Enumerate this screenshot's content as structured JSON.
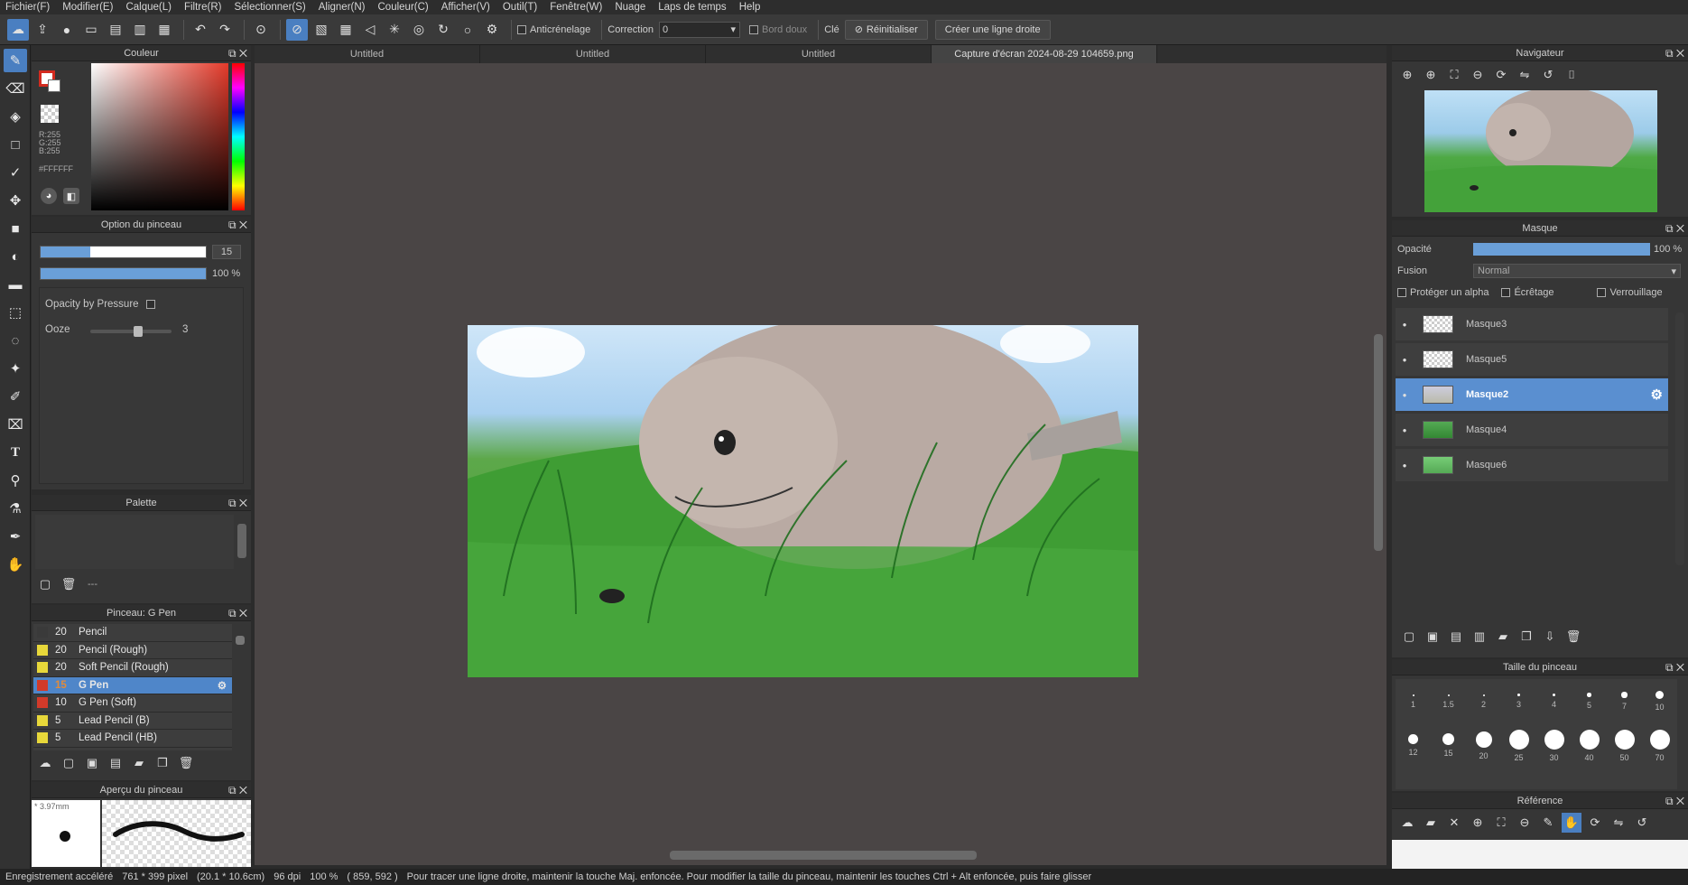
{
  "menu": [
    "Fichier(F)",
    "Modifier(E)",
    "Calque(L)",
    "Filtre(R)",
    "Sélectionner(S)",
    "Aligner(N)",
    "Couleur(C)",
    "Afficher(V)",
    "Outil(T)",
    "Fenêtre(W)",
    "Nuage",
    "Laps de temps",
    "Help"
  ],
  "toolbar": {
    "antialias": "Anticrénelage",
    "correction_label": "Correction",
    "correction_value": "0",
    "soft_edge": "Bord doux",
    "key": "Clé",
    "reset": "Réinitialiser",
    "straight_line": "Créer une ligne droite"
  },
  "tabs": [
    "Untitled",
    "Untitled",
    "Untitled",
    "Capture d'écran 2024-08-29 104659.png"
  ],
  "color_panel": {
    "title": "Couleur",
    "r": "R:255",
    "g": "G:255",
    "b": "B:255",
    "hex": "#FFFFFF"
  },
  "brush_option": {
    "title": "Option du pinceau",
    "size": "15",
    "opacity": "100 %",
    "opacity_by_pressure": "Opacity by Pressure",
    "ooze_label": "Ooze",
    "ooze_value": "3"
  },
  "palette": {
    "title": "Palette",
    "dash": "---"
  },
  "brush_list": {
    "title": "Pinceau: G Pen",
    "items": [
      {
        "size": "20",
        "name": "Pencil",
        "color": "#3a3a3a"
      },
      {
        "size": "20",
        "name": "Pencil (Rough)",
        "color": "#e8d83a"
      },
      {
        "size": "20",
        "name": "Soft Pencil (Rough)",
        "color": "#e8d83a"
      },
      {
        "size": "15",
        "name": "G Pen",
        "color": "#d23a2a"
      },
      {
        "size": "10",
        "name": "G Pen (Soft)",
        "color": "#d23a2a"
      },
      {
        "size": "5",
        "name": "Lead Pencil (B)",
        "color": "#e8d83a"
      },
      {
        "size": "5",
        "name": "Lead Pencil (HB)",
        "color": "#e8d83a"
      }
    ],
    "selected": 3
  },
  "brush_preview": {
    "title": "Aperçu du pinceau",
    "size": "* 3.97mm"
  },
  "navigator": {
    "title": "Navigateur"
  },
  "layers": {
    "title": "Masque",
    "opacity_label": "Opacité",
    "opacity_value": "100 %",
    "blend_label": "Fusion",
    "blend_value": "Normal",
    "protect_alpha": "Protéger un alpha",
    "clipping": "Écrêtage",
    "lock": "Verrouillage",
    "items": [
      "Masque3",
      "Masque5",
      "Masque2",
      "Masque4",
      "Masque6"
    ],
    "selected": 2
  },
  "brush_size": {
    "title": "Taille du pinceau",
    "labels": [
      "1",
      "1.5",
      "2",
      "3",
      "4",
      "5",
      "7",
      "10",
      "12",
      "15",
      "20",
      "25",
      "30",
      "40",
      "50",
      "70"
    ]
  },
  "reference": {
    "title": "Référence"
  },
  "status": {
    "accel": "Enregistrement accéléré",
    "size": "761 * 399 pixel",
    "cm": "(20.1 * 10.6cm)",
    "dpi": "96 dpi",
    "zoom": "100 %",
    "coords": "( 859, 592 )",
    "hint": "Pour tracer une ligne droite, maintenir la touche Maj. enfoncée. Pour modifier la taille du pinceau, maintenir les touches Ctrl + Alt enfoncée, puis faire glisser"
  }
}
